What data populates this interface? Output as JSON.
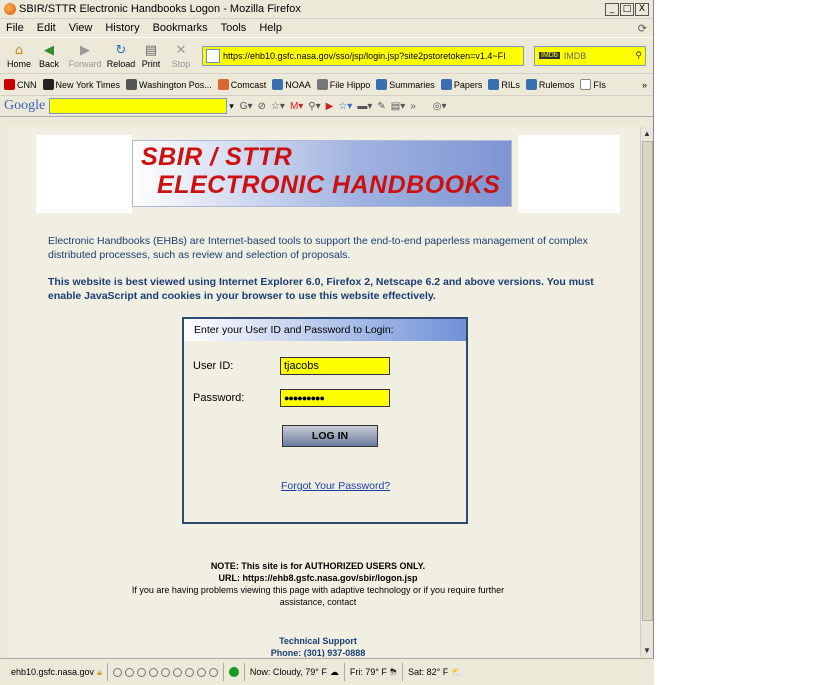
{
  "window": {
    "title": "SBIR/STTR Electronic Handbooks Logon - Mozilla Firefox",
    "buttons": [
      "_",
      "□",
      "X"
    ]
  },
  "menu": [
    "File",
    "Edit",
    "View",
    "History",
    "Bookmarks",
    "Tools",
    "Help"
  ],
  "toolbar": {
    "home": "Home",
    "back": "Back",
    "forward": "Forward",
    "reload": "Reload",
    "print": "Print",
    "stop": "Stop",
    "url": "https://ehb10.gsfc.nasa.gov/sso/jsp/login.jsp?site2pstoretoken=v1.4~FI",
    "search_placeholder": "IMDB"
  },
  "bookmarks": [
    "CNN",
    "New York Times",
    "Washington Pos...",
    "Comcast",
    "NOAA",
    "File Hippo",
    "Summaries",
    "Papers",
    "RILs",
    "Rulemos",
    "FIs"
  ],
  "google": {
    "logo": "Google"
  },
  "page": {
    "banner_line1": "SBIR / STTR",
    "banner_line2": "ELECTRONIC HANDBOOKS",
    "intro": "Electronic Handbooks (EHBs) are Internet-based tools to support the end-to-end paperless management of complex distributed processes, such as review and selection of proposals.",
    "browser_note": "This website is best viewed using Internet Explorer 6.0, Firefox 2, Netscape 6.2 and above versions. You must enable JavaScript and cookies in your browser to use this website effectively.",
    "login": {
      "heading": "Enter your User ID and Password to Login:",
      "userid_label": "User ID:",
      "userid_value": "tjacobs",
      "password_label": "Password:",
      "password_value": "●●●●●●●●●",
      "button": "LOG IN",
      "forgot": "Forgot Your Password?"
    },
    "note_line1": "NOTE: This site is for AUTHORIZED USERS ONLY.",
    "note_line2": "URL: https://ehb8.gsfc.nasa.gov/sbir/logon.jsp",
    "note_line3": "If you are having problems viewing this page with adaptive technology or if you require further assistance, contact",
    "support_title": "Technical Support",
    "support_phone": "Phone: (301) 937-0888"
  },
  "status": {
    "host": "ehb10.gsfc.nasa.gov",
    "weather_now": "Now: Cloudy, 79° F",
    "weather_fri": "Fri: 79° F",
    "weather_sat": "Sat: 82° F"
  }
}
